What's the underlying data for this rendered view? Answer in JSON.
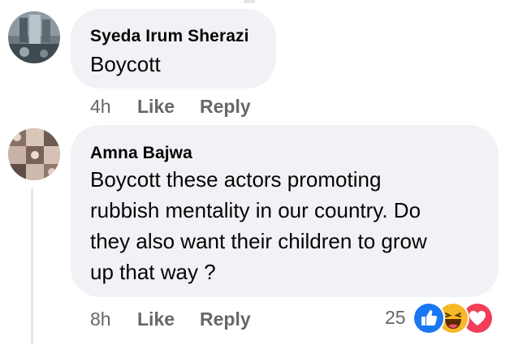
{
  "comments": [
    {
      "author": "Syeda Irum Sherazi",
      "lines": [
        "Boycott"
      ],
      "time": "4h",
      "like_label": "Like",
      "reply_label": "Reply"
    },
    {
      "author": "Amna Bajwa",
      "lines": [
        "Boycott these actors promoting",
        "rubbish mentality in our country. Do",
        "they also want their children to grow",
        "up that way ?"
      ],
      "time": "8h",
      "like_label": "Like",
      "reply_label": "Reply",
      "reaction_count": "25",
      "reactions": [
        "like-icon",
        "haha-icon",
        "love-icon"
      ]
    }
  ],
  "colors": {
    "bubble": "#f0f2f5",
    "meta_text": "#65676b",
    "like_blue": "#1877f2",
    "haha_yellow": "#f7b928",
    "love_red": "#f33e58"
  }
}
